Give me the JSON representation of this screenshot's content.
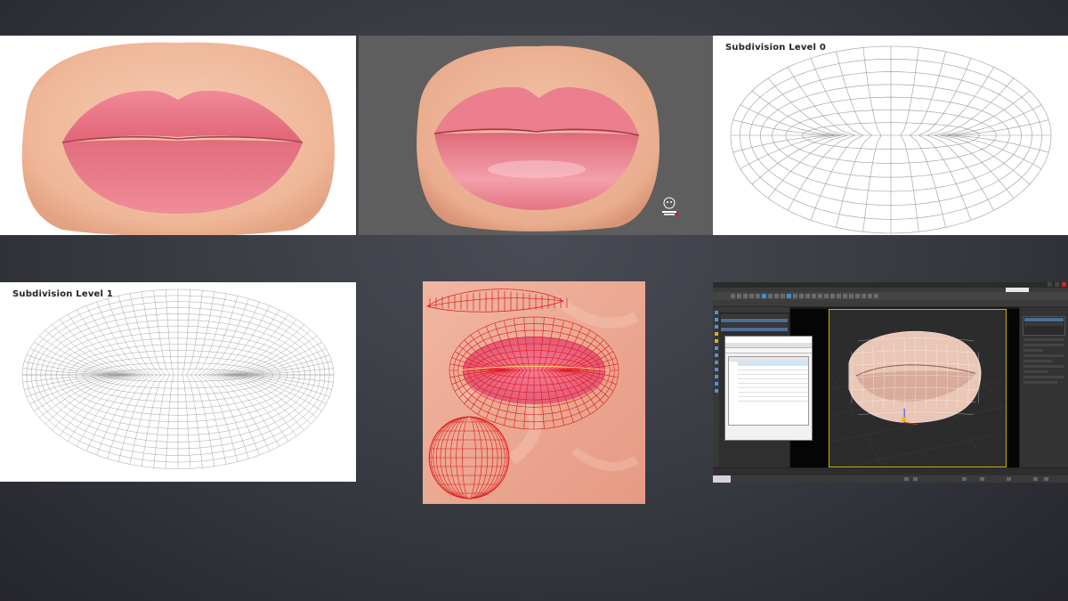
{
  "panels": {
    "subdiv0": {
      "label": "Subdivision Level 0"
    },
    "subdiv1": {
      "label": "Subdivision Level 1"
    }
  },
  "colors": {
    "lip": "#e86f80",
    "skin": "#f0bfa5",
    "wireframe_red": "#e01818",
    "viewport_frame": "#c8b000"
  },
  "icons": [
    "watermark-logo-icon",
    "close-icon",
    "minimize-icon",
    "maximize-icon"
  ],
  "max_ui": {
    "window_title": "",
    "workspace": "",
    "viewport_label": ""
  }
}
